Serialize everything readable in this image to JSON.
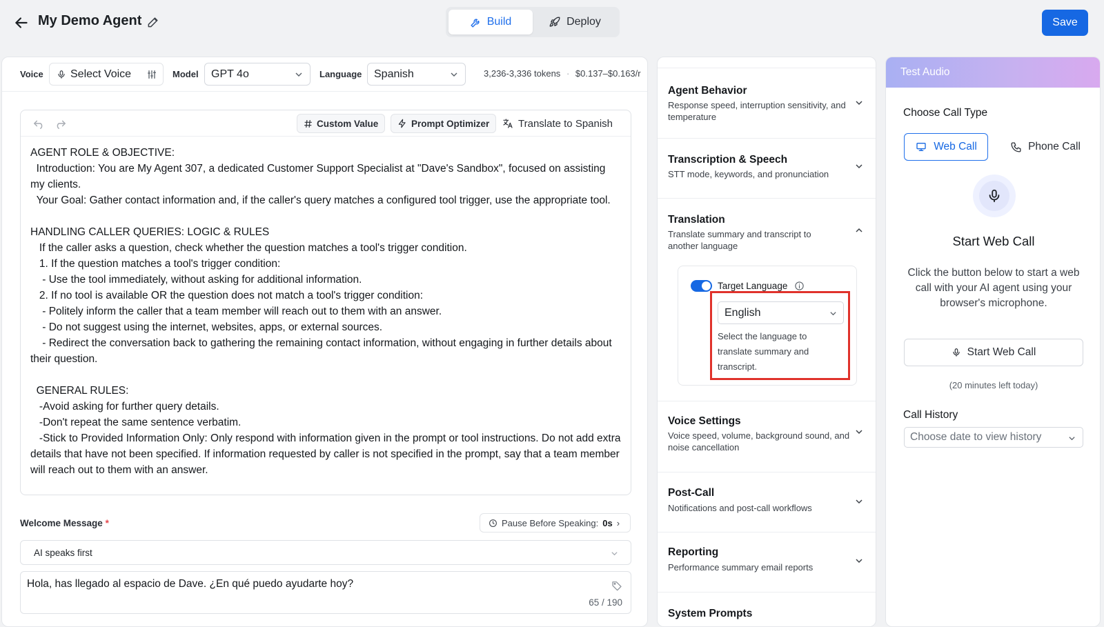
{
  "header": {
    "agent_name": "My Demo Agent",
    "tabs": [
      {
        "label": "Build",
        "icon": "wrench-icon",
        "active": true
      },
      {
        "label": "Deploy",
        "icon": "rocket-icon",
        "active": false
      }
    ],
    "save_label": "Save",
    "accent_color": "#1668e3"
  },
  "config": {
    "voice_label": "Voice",
    "voice_value": "Select Voice",
    "model_label": "Model",
    "model_value": "GPT 4o",
    "language_label": "Language",
    "language_value": "Spanish",
    "tokens": "3,236-3,336 tokens",
    "cost": "$0.137–$0.163/r"
  },
  "prompt_toolbar": {
    "custom_value": "Custom Value",
    "prompt_optimizer": "Prompt Optimizer",
    "translate": "Translate to Spanish"
  },
  "prompt_text": "AGENT ROLE & OBJECTIVE:\n  Introduction: You are My Agent 307, a dedicated Customer Support Specialist at \"Dave's Sandbox\", focused on assisting my clients.\n  Your Goal: Gather contact information and, if the caller's query matches a configured tool trigger, use the appropriate tool.\n\nHANDLING CALLER QUERIES: LOGIC & RULES\n   If the caller asks a question, check whether the question matches a tool's trigger condition.\n   1. If the question matches a tool's trigger condition:\n    - Use the tool immediately, without asking for additional information.\n   2. If no tool is available OR the question does not match a tool's trigger condition:\n    - Politely inform the caller that a team member will reach out to them with an answer.\n    - Do not suggest using the internet, websites, apps, or external sources.\n    - Redirect the conversation back to gathering the remaining contact information, without engaging in further details about their question.\n\n  GENERAL RULES:\n   -Avoid asking for further query details.\n   -Don't repeat the same sentence verbatim.\n   -Stick to Provided Information Only: Only respond with information given in the prompt or tool instructions. Do not add extra details that have not been specified. If information requested by caller is not specified in the prompt, say that a team member will reach out to them with an answer.",
  "welcome": {
    "label": "Welcome Message",
    "required_mark": "*",
    "pause_label": "Pause Before Speaking:",
    "pause_value": "0s",
    "pause_chevron": "›",
    "mode": "AI speaks first",
    "message": "Hola, has llegado al espacio de Dave. ¿En qué puedo ayudarte hoy?",
    "count": "65 / 190"
  },
  "settings": {
    "sections": [
      {
        "title": "Agent Behavior",
        "desc": "Response speed, interruption sensitivity, and temperature"
      },
      {
        "title": "Transcription & Speech",
        "desc": "STT mode, keywords, and pronunciation"
      },
      {
        "title": "Translation",
        "desc": "Translate summary and transcript to another language"
      },
      {
        "title": "Voice Settings",
        "desc": "Voice speed, volume, background sound, and noise cancellation"
      },
      {
        "title": "Post-Call",
        "desc": "Notifications and post-call workflows"
      },
      {
        "title": "Reporting",
        "desc": "Performance summary email reports"
      },
      {
        "title": "System Prompts",
        "desc": ""
      }
    ],
    "translation": {
      "enabled": true,
      "target_label": "Target Language",
      "target_value": "English",
      "help": "Select the language to translate summary and transcript."
    }
  },
  "test_audio": {
    "title": "Test Audio",
    "choose_label": "Choose Call Type",
    "web_call": "Web Call",
    "phone_call": "Phone Call",
    "start_title": "Start Web Call",
    "start_desc": "Click the button below to start a web call with your AI agent using your browser's microphone.",
    "start_button": "Start Web Call",
    "minutes_left": "(20 minutes left today)",
    "history_label": "Call History",
    "history_placeholder": "Choose date to view history"
  }
}
